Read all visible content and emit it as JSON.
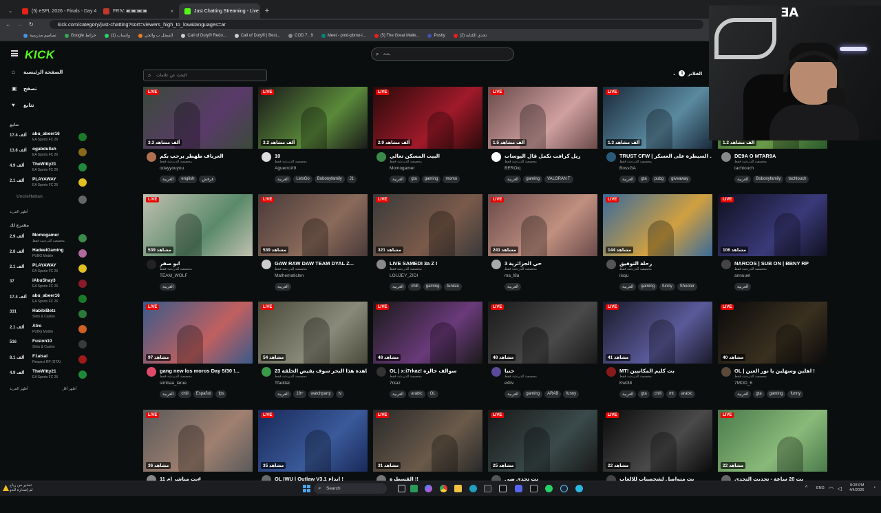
{
  "browser": {
    "tabs": [
      {
        "title": "(5) eSPL 2026 - Finals - Day 4 |",
        "color": "#e62117",
        "active": false
      },
      {
        "title": "FRIV: ◙◘◙◘◙◘◙",
        "color": "#c0392b",
        "active": false
      },
      {
        "title": "Just Chatting Streaming - Live",
        "color": "#53fc18",
        "active": true
      }
    ],
    "new_tab": "+",
    "url": "kick.com/category/just-chatting?sort=viewers_high_to_low&languages=ar",
    "bookmarks": [
      {
        "label": "تصاميم مدرسية",
        "color": "#4a90e2"
      },
      {
        "label": "Google خرائط",
        "color": "#34a853"
      },
      {
        "label": "واتساب (1)",
        "color": "#25d366"
      },
      {
        "label": "السجل ب والخي",
        "color": "#e67e22"
      },
      {
        "label": "Call of Duty® Redo...",
        "color": "#cccccc"
      },
      {
        "label": "Call of Duty® | Best...",
        "color": "#cccccc"
      },
      {
        "label": "COD 7 , 9",
        "color": "#888888"
      },
      {
        "label": "Meet - pmd-pbmo-i...",
        "color": "#00897b"
      },
      {
        "label": "(5) The Great Malle...",
        "color": "#e62117"
      },
      {
        "label": "Postly",
        "color": "#3f51b5"
      },
      {
        "label": "تحدي الكتابة (2)",
        "color": "#e62117"
      }
    ]
  },
  "header": {
    "logo": "KICK",
    "search_placeholder": "بحث"
  },
  "sidebar": {
    "nav": [
      {
        "label": "الصفحة الرئيسية",
        "icon": "⌂"
      },
      {
        "label": "تصفح",
        "icon": "▣"
      },
      {
        "label": "تتابع",
        "icon": "♥"
      }
    ],
    "following_head": "تتابع",
    "following": [
      {
        "viewers": "17.4 ألف",
        "name": "abu_abeer16",
        "game": "EA Sports FC 26",
        "color": "#1a7a2a"
      },
      {
        "viewers": "13.8 ألف",
        "name": "ogabdullah",
        "game": "EA Sports FC 26",
        "color": "#8a6a1a"
      },
      {
        "viewers": "4.9 ألف",
        "name": "TheWitty21",
        "game": "EA Sports FC 26",
        "color": "#1f8a3a"
      },
      {
        "viewers": "2.1 ألف",
        "name": "PLAYAWAY",
        "game": "EA Sports FC 26",
        "color": "#e0c020"
      }
    ],
    "offline": {
      "name": "UncleHattan",
      "color": "#666"
    },
    "following_more": "أظهر المزيد",
    "recommended_head": "مقترح لك",
    "recommended": [
      {
        "viewers": "2.9 ألف",
        "name": "Momogamer",
        "game": "مخصصة للدردشة فقط",
        "color": "#3a8a4a"
      },
      {
        "viewers": "2.8 ألف",
        "name": "HadeelGaming",
        "game": "PUBG Mobile",
        "color": "#b06aa0"
      },
      {
        "viewers": "2.1 ألف",
        "name": "PLAYAWAY",
        "game": "EA Sports FC 26",
        "color": "#e0c020"
      },
      {
        "viewers": "37",
        "name": "iAbuShay3",
        "game": "EA Sports FC 26",
        "color": "#8a1a2a"
      },
      {
        "viewers": "17.4 ألف",
        "name": "abu_abeer16",
        "game": "EA Sports FC 26",
        "color": "#1a7a2a"
      },
      {
        "viewers": "331",
        "name": "HabibiBetz",
        "game": "Slots & Casino",
        "color": "#2a7a3a"
      },
      {
        "viewers": "2.1 ألف",
        "name": "Atro",
        "game": "PUBG Mobile",
        "color": "#d06020"
      },
      {
        "viewers": "516",
        "name": "Fusion10",
        "game": "Slots & Casino",
        "color": "#3a3a3a"
      },
      {
        "viewers": "8.1 ألف",
        "name": "F1aisal",
        "game": "Respect RP (GTA)",
        "color": "#a01a1a"
      },
      {
        "viewers": "4.9 ألف",
        "name": "TheWitty21",
        "game": "EA Sports FC 26",
        "color": "#1f8a3a"
      }
    ],
    "recommended_more_a": "أظهر المزيد",
    "recommended_more_b": "أظهر أقل"
  },
  "filters": {
    "tag_search_placeholder": "البحث عن علامات",
    "filter_label": "الفلاتر",
    "filter_count": "1"
  },
  "live_label": "LIVE",
  "streams": [
    {
      "viewers": "3.3 ألف مشاهد",
      "title": "العرباف طهطر يرحب بكم",
      "category": "مخصصة للدردشة فقط",
      "user": "odayyouyou",
      "tags": [
        "العربية",
        "english",
        "فرفش"
      ],
      "c1": "#3a4a3a",
      "c2": "#5a3a6a",
      "av": "#b07050"
    },
    {
      "viewers": "3.2 ألف مشاهد",
      "title": "10",
      "category": "مخصصة للدردشة فقط",
      "user": "AguerroX9",
      "tags": [
        "العربية",
        "LetsGo",
        "Bobonyfamily",
        "J1"
      ],
      "c1": "#1a1a1a",
      "c2": "#5a8a3a",
      "av": "#dddddd"
    },
    {
      "viewers": "2.9 ألف مشاهد",
      "title": "البيت المسكن تعالي",
      "category": "مخصصة للدردشة فقط",
      "user": "Momogamer",
      "tags": [
        "العربية",
        "gta",
        "gaming",
        "momo"
      ],
      "c1": "#2a0a0a",
      "c2": "#a01a2a",
      "av": "#3a8a4a"
    },
    {
      "viewers": "1.5 ألف مشاهد",
      "title": "ريل كرافت نكمل قال اليوسات",
      "category": "مخصصة للدردشة فقط",
      "user": "BEROiq",
      "tags": [
        "العربية",
        "gaming",
        "VALORAN T"
      ],
      "c1": "#6a4a4a",
      "c2": "#d0a0a0",
      "av": "#ffffff"
    },
    {
      "viewers": "1.3 ألف مشاهد",
      "title": "TRUST CFW | السيطرة على العسكر ...",
      "category": "مخصصة للدردشة فقط",
      "user": "BossGA",
      "tags": [
        "العربية",
        "gta",
        "pubg",
        "giveaway"
      ],
      "c1": "#1a2a3a",
      "c2": "#5a8aa0",
      "av": "#2a5a7a"
    },
    {
      "viewers": "1.2 ألف مشاهد",
      "title": "DE9A O MTAR9A",
      "category": "مخصصة للدردشة فقط",
      "user": "tachtouch",
      "tags": [
        "العربية",
        "Bobonyfamily",
        "tachtouch"
      ],
      "c1": "#2a5a2a",
      "c2": "#6a9a4a",
      "av": "#888888"
    },
    {
      "viewers": "539 مشاهد",
      "title": "ابو صقر",
      "category": "مخصصة للدردشة فقط",
      "user": "TEAM_WOLF",
      "tags": [
        "العربية"
      ],
      "c1": "#c0c0b0",
      "c2": "#5a8a6a",
      "av": "#222222"
    },
    {
      "viewers": "539 مشاهد",
      "title": "GAW RAW DAW TEAM DYAL Z...",
      "category": "مخصصة للدردشة فقط",
      "user": "Mathematiclen",
      "tags": [
        "العربية"
      ],
      "c1": "#4a3a3a",
      "c2": "#8a6a5a",
      "av": "#cccccc"
    },
    {
      "viewers": "321 مشاهد",
      "title": "LIVE SAMEDI 3a Z !",
      "category": "مخصصة للدردشة فقط",
      "user": "LOUJEY_ZIDI",
      "tags": [
        "العربية",
        "chill",
        "gaming",
        "tunisie"
      ],
      "c1": "#3a3a3a",
      "c2": "#7a5a4a",
      "av": "#8a8a8a"
    },
    {
      "viewers": "241 مشاهد",
      "title": "حي الجزائرية 3",
      "category": "مخصصة للدردشة فقط",
      "user": "ma_l8a",
      "tags": [
        "العربية"
      ],
      "c1": "#6a4a4a",
      "c2": "#c09080",
      "av": "#aaaaaa"
    },
    {
      "viewers": "144 مشاهد",
      "title": "رحلة التوفيق",
      "category": "مخصصة للدردشة فقط",
      "user": "iisqu",
      "tags": [
        "العربية",
        "gaming",
        "funny",
        "Shooter"
      ],
      "c1": "#3a6a9a",
      "c2": "#d0a040",
      "av": "#555555"
    },
    {
      "viewers": "106 مشاهد",
      "title": "NARCOS | SUB ON | BBNY RP",
      "category": "مخصصة للدردشة فقط",
      "user": "annuuel",
      "tags": [
        "العربية"
      ],
      "c1": "#101020",
      "c2": "#3a3a7a",
      "av": "#444444"
    },
    {
      "viewers": "97 مشاهد",
      "title": "gang new los moros Day 5/30 !...",
      "category": "مخصصة للدردشة فقط",
      "user": "simbaa_larue",
      "tags": [
        "العربية",
        "chill",
        "Español",
        "fps"
      ],
      "c1": "#3a5a8a",
      "c2": "#c06060",
      "av": "#e04a6a"
    },
    {
      "viewers": "54 مشاهد",
      "title": "مشاهدة هذا البحر سوف يقيض الحلقة 23",
      "category": "مخصصة للدردشة فقط",
      "user": "Tfaddal",
      "tags": [
        "العربية",
        "18+",
        "watchparty",
        "tv"
      ],
      "c1": "#4a4a3a",
      "c2": "#8a8a7a",
      "av": "#3a9a4a"
    },
    {
      "viewers": "48 مشاهد",
      "title": "OL | x:i7rkaz! سوالف خالزه",
      "category": "مخصصة للدردشة فقط",
      "user": "7rkaz",
      "tags": [
        "العربية",
        "arabic",
        "OL"
      ],
      "c1": "#1a1a1a",
      "c2": "#6a3a7a",
      "av": "#333333"
    },
    {
      "viewers": "48 مشاهد",
      "title": "حنبا",
      "category": "مخصصة للدردشة فقط",
      "user": "e4liv",
      "tags": [
        "العربية",
        "gaming",
        "ARAB",
        "funny"
      ],
      "c1": "#1a1a1a",
      "c2": "#4a4a4a",
      "av": "#5a4a9a"
    },
    {
      "viewers": "41 مشاهد",
      "title": "MT! بث كليم المكانيين",
      "category": "مخصصة للدردشة فقط",
      "user": "Kwt38",
      "tags": [
        "العربية",
        "gta",
        "chill",
        "mt",
        "arabic"
      ],
      "c1": "#1a1a2a",
      "c2": "#5a5a9a",
      "av": "#8a1a1a"
    },
    {
      "viewers": "40 مشاهد",
      "title": "OL | اهلين وسهلين يا نور العين !",
      "category": "مخصصة للدردشة فقط",
      "user": "7MOD_6",
      "tags": [
        "العربية",
        "gta",
        "gaming",
        "funny"
      ],
      "c1": "#0a0a0a",
      "c2": "#3a3020",
      "av": "#5a4a3a"
    },
    {
      "viewers": "36 مشاهد",
      "title": "بث مباشر ام 11#",
      "category": "مخصصة للدردشة فقط",
      "user": "",
      "tags": [],
      "c1": "#5a5a5a",
      "c2": "#a08070",
      "av": "#888888"
    },
    {
      "viewers": "35 مشاهد",
      "title": "OL IWU | Outlaw V3.1 ابداع !",
      "category": "مخصصة للدردشة فقط",
      "user": "",
      "tags": [],
      "c1": "#1a2a5a",
      "c2": "#3a5a9a",
      "av": "#6a6a6a"
    },
    {
      "viewers": "31 مشاهد",
      "title": "القسطرة !!",
      "category": "مخصصة للدردشة فقط",
      "user": "",
      "tags": [],
      "c1": "#2a2a2a",
      "c2": "#6a5a4a",
      "av": "#777777"
    },
    {
      "viewers": "25 مشاهد",
      "title": "بث تحدي ضي",
      "category": "مخصصة للدردشة فقط",
      "user": "",
      "tags": [],
      "c1": "#1a1a1a",
      "c2": "#3a4a4a",
      "av": "#555555"
    },
    {
      "viewers": "22 مشاهد",
      "title": "بث متواصل لشخصيات للالعاب",
      "category": "مخصصة للدردشة فقط",
      "user": "",
      "tags": [],
      "c1": "#0a0a0a",
      "c2": "#4a4a4a",
      "av": "#444444"
    },
    {
      "viewers": "22 مشاهد",
      "title": "بث 20 ساعة - تحديث التحدي",
      "category": "مخصصة للدردشة فقط",
      "user": "",
      "tags": [],
      "c1": "#4a7a4a",
      "c2": "#8aba7a",
      "av": "#666666"
    }
  ],
  "overlay": {
    "brand": "ƎA"
  },
  "taskbar": {
    "weather_line1": "تحذير من رياح",
    "weather_line2": "لم إصدارة للدو",
    "search_label": "Search",
    "lang": "ENG",
    "time": "8:28 PM",
    "date": "4/4/2026"
  }
}
